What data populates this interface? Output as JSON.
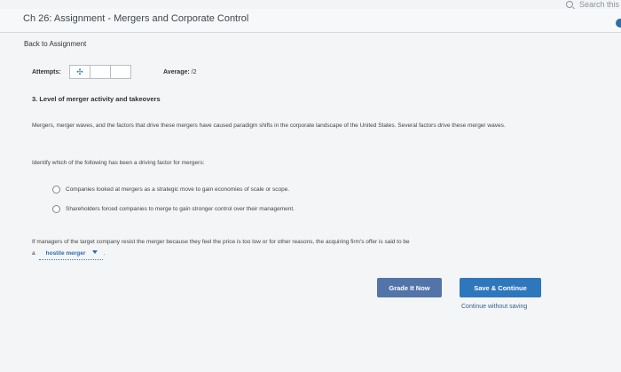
{
  "search": {
    "label": "Search this"
  },
  "header": {
    "title": "Ch 26: Assignment - Mergers and Corporate Control"
  },
  "nav": {
    "back_label": "Back to Assignment"
  },
  "attempts": {
    "label": "Attempts:",
    "icon": "✣"
  },
  "average": {
    "label": "Average:",
    "value": "/2"
  },
  "question": {
    "title": "3. Level of merger activity and takeovers",
    "intro": "Mergers, merger waves, and the factors that drive these mergers have caused paradigm shifts in the corporate landscape of the United States. Several factors drive these merger waves.",
    "prompt": "Identify which of the following has been a driving factor for mergers:",
    "options": [
      "Companies looked at mergers as a strategic move to gain economies of scale or scope.",
      "Shareholders forced companies to merge to gain stronger control over their management."
    ],
    "fill_text": "If managers of the target company resist the merger because they feel the price is too low or for other reasons, the acquiring firm's offer is said to be",
    "fill_prefix": "a",
    "dropdown_value": "hostile merger",
    "fill_suffix": "."
  },
  "buttons": {
    "grade": "Grade It Now",
    "save": "Save & Continue",
    "continue_without": "Continue without saving"
  }
}
